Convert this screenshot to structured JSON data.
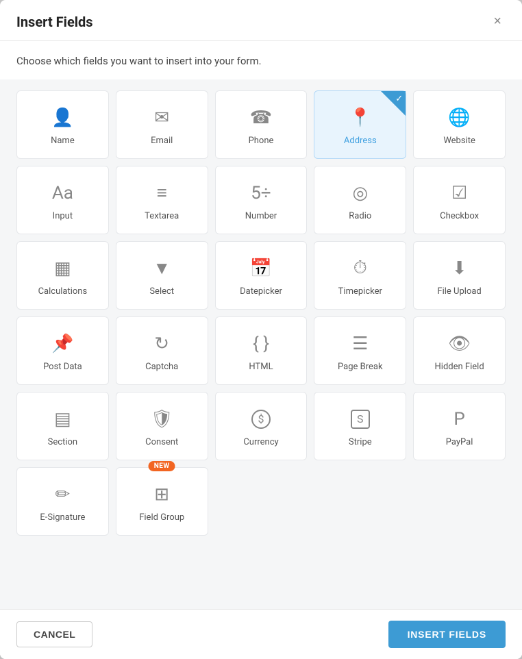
{
  "modal": {
    "title": "Insert Fields",
    "subtitle": "Choose which fields you want to insert into your form.",
    "close_label": "×"
  },
  "fields": [
    {
      "id": "name",
      "label": "Name",
      "icon": "person",
      "selected": false
    },
    {
      "id": "email",
      "label": "Email",
      "icon": "email",
      "selected": false
    },
    {
      "id": "phone",
      "label": "Phone",
      "icon": "phone",
      "selected": false
    },
    {
      "id": "address",
      "label": "Address",
      "icon": "address",
      "selected": true
    },
    {
      "id": "website",
      "label": "Website",
      "icon": "website",
      "selected": false
    },
    {
      "id": "input",
      "label": "Input",
      "icon": "input",
      "selected": false
    },
    {
      "id": "textarea",
      "label": "Textarea",
      "icon": "textarea",
      "selected": false
    },
    {
      "id": "number",
      "label": "Number",
      "icon": "number",
      "selected": false
    },
    {
      "id": "radio",
      "label": "Radio",
      "icon": "radio",
      "selected": false
    },
    {
      "id": "checkbox",
      "label": "Checkbox",
      "icon": "checkbox",
      "selected": false
    },
    {
      "id": "calculations",
      "label": "Calculations",
      "icon": "calculations",
      "selected": false
    },
    {
      "id": "select",
      "label": "Select",
      "icon": "select",
      "selected": false
    },
    {
      "id": "datepicker",
      "label": "Datepicker",
      "icon": "datepicker",
      "selected": false
    },
    {
      "id": "timepicker",
      "label": "Timepicker",
      "icon": "timepicker",
      "selected": false
    },
    {
      "id": "fileupload",
      "label": "File Upload",
      "icon": "fileupload",
      "selected": false
    },
    {
      "id": "postdata",
      "label": "Post Data",
      "icon": "postdata",
      "selected": false
    },
    {
      "id": "captcha",
      "label": "Captcha",
      "icon": "captcha",
      "selected": false
    },
    {
      "id": "html",
      "label": "HTML",
      "icon": "html",
      "selected": false
    },
    {
      "id": "pagebreak",
      "label": "Page Break",
      "icon": "pagebreak",
      "selected": false
    },
    {
      "id": "hiddenfield",
      "label": "Hidden Field",
      "icon": "hiddenfield",
      "selected": false
    },
    {
      "id": "section",
      "label": "Section",
      "icon": "section",
      "selected": false
    },
    {
      "id": "consent",
      "label": "Consent",
      "icon": "consent",
      "selected": false
    },
    {
      "id": "currency",
      "label": "Currency",
      "icon": "currency",
      "selected": false
    },
    {
      "id": "stripe",
      "label": "Stripe",
      "icon": "stripe",
      "selected": false
    },
    {
      "id": "paypal",
      "label": "PayPal",
      "icon": "paypal",
      "selected": false
    },
    {
      "id": "esignature",
      "label": "E-Signature",
      "icon": "esignature",
      "selected": false,
      "isNew": false
    },
    {
      "id": "fieldgroup",
      "label": "Field Group",
      "icon": "fieldgroup",
      "selected": false,
      "isNew": true
    }
  ],
  "footer": {
    "cancel_label": "CANCEL",
    "insert_label": "INSERT FIELDS"
  }
}
